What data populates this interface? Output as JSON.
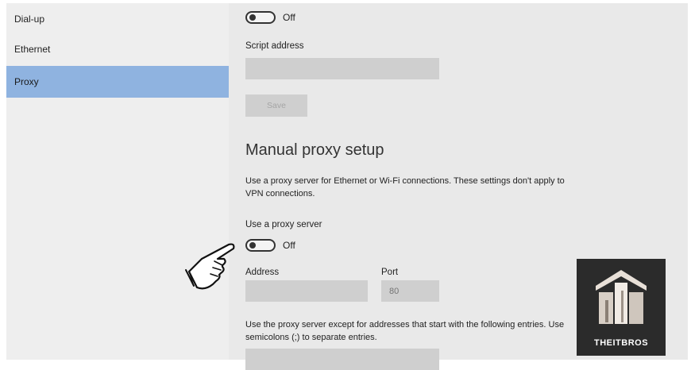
{
  "sidebar": {
    "items": [
      {
        "label": "Dial-up",
        "selected": false
      },
      {
        "label": "Ethernet",
        "selected": false
      },
      {
        "label": "Proxy",
        "selected": true
      }
    ]
  },
  "auto_setup": {
    "toggle_state": "Off",
    "script_address_label": "Script address",
    "script_address_value": "",
    "save_label": "Save"
  },
  "manual_setup": {
    "heading": "Manual proxy setup",
    "description": "Use a proxy server for Ethernet or Wi-Fi connections. These settings don't apply to VPN connections.",
    "use_proxy_label": "Use a proxy server",
    "use_proxy_state": "Off",
    "address_label": "Address",
    "address_value": "",
    "port_label": "Port",
    "port_placeholder": "80",
    "exceptions_description": "Use the proxy server except for addresses that start with the following entries. Use semicolons (;) to separate entries."
  },
  "watermark": {
    "brand": "THEITBROS"
  },
  "colors": {
    "selected_nav": "#8fb3e0",
    "field_bg": "#cfcfcf",
    "content_bg": "#e9e9e9",
    "logo_bg": "#2b2b2b"
  }
}
